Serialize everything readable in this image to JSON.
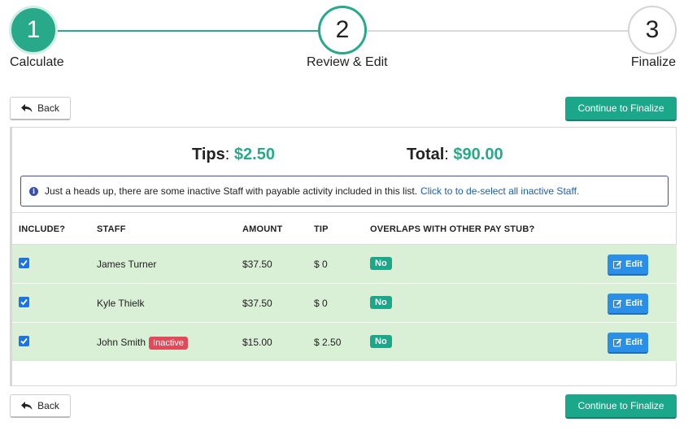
{
  "stepper": {
    "steps": [
      {
        "number": "1",
        "label": "Calculate"
      },
      {
        "number": "2",
        "label": "Review & Edit"
      },
      {
        "number": "3",
        "label": "Finalize"
      }
    ],
    "colors": {
      "complete": "#27a98a",
      "pending": "#d9d9d9"
    }
  },
  "actions": {
    "back_label": "Back",
    "continue_label": "Continue to Finalize"
  },
  "summary": {
    "tips_label": "Tips",
    "tips_value": "$2.50",
    "total_label": "Total",
    "total_value": "$90.00"
  },
  "alert": {
    "icon": "info-icon",
    "message": "Just a heads up, there are some inactive Staff with payable activity included in this list.",
    "link_text": "Click to to de-select all inactive Staff."
  },
  "table": {
    "headers": {
      "include": "INCLUDE?",
      "staff": "STAFF",
      "amount": "AMOUNT",
      "tip": "TIP",
      "overlaps": "OVERLAPS WITH OTHER PAY STUB?"
    },
    "rows": [
      {
        "included": true,
        "staff": "James Turner",
        "badge": "",
        "amount": "$37.50",
        "tip": "$ 0",
        "overlaps": "No",
        "edit_label": "Edit"
      },
      {
        "included": true,
        "staff": "Kyle Thielk",
        "badge": "",
        "amount": "$37.50",
        "tip": "$ 0",
        "overlaps": "No",
        "edit_label": "Edit"
      },
      {
        "included": true,
        "staff": "John Smith",
        "badge": "Inactive",
        "amount": "$15.00",
        "tip": "$ 2.50",
        "overlaps": "No",
        "edit_label": "Edit"
      }
    ]
  }
}
